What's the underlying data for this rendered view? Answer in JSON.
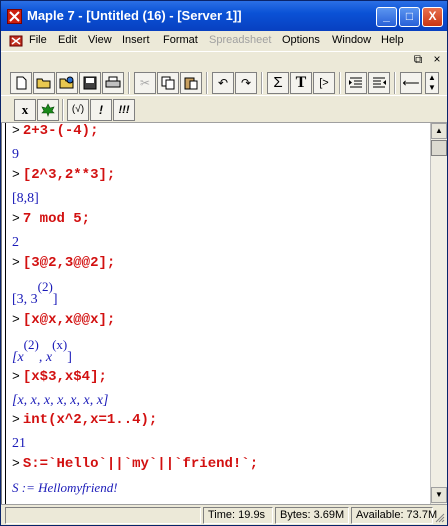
{
  "window": {
    "title": "Maple 7 - [Untitled (16) - [Server 1]]",
    "title_buttons": [
      "_",
      "□",
      "X"
    ]
  },
  "menubar": {
    "items": [
      "File",
      "Edit",
      "View",
      "Insert",
      "Format",
      "Spreadsheet",
      "Options",
      "Window",
      "Help"
    ],
    "disabled": [
      "Spreadsheet"
    ],
    "mdi_buttons": [
      "_",
      "⧉",
      "×"
    ]
  },
  "toolbar": {
    "icons": [
      "new-file-icon",
      "open-folder-icon",
      "open-url-icon",
      "save-icon",
      "print-icon",
      "cut-icon",
      "copy-icon",
      "paste-icon",
      "undo-icon",
      "redo-icon",
      "sum-icon",
      "text-icon",
      "prompt-icon",
      "indent-icon",
      "outdent-icon",
      "back-icon",
      "scroll-icon"
    ],
    "sigma": "Σ",
    "text_T": "T",
    "prompt_label": "[>"
  },
  "toolbar2": {
    "x_label": "x",
    "tree_icon": "maple-leaf-icon",
    "sqrt_label": "(√)",
    "exec_label": "!",
    "execall_label": "!!!"
  },
  "worksheet": {
    "prompt_symbol": ">",
    "entries": [
      {
        "input": "2+3-(-4);",
        "output": "9"
      },
      {
        "input": "[2^3,2**3];",
        "output": "[8,8]"
      },
      {
        "input": "7 mod 5;",
        "output": "2"
      },
      {
        "input": "[3@2,3@@2];",
        "output_base": "[3, 3",
        "output_sup": "(2)",
        "output_end": "]"
      },
      {
        "input": "[x@x,x@@x];",
        "output_base1": "[x",
        "output_sup1": "(2)",
        "output_mid": ", x",
        "output_sup2": "(x)",
        "output_end": "]"
      },
      {
        "input": "[x$3,x$4];",
        "output": "[x, x, x, x, x, x, x]"
      },
      {
        "input": "int(x^2,x=1..4);",
        "output": "21"
      },
      {
        "input": "S:=`Hello`||`my`||`friend!`;",
        "output": "S := Hellomyfriend!"
      }
    ]
  },
  "statusbar": {
    "time": "Time:  19.9s",
    "bytes": "Bytes: 3.69M",
    "available": "Available: 73.7M"
  },
  "colors": {
    "input": "#d21010",
    "output": "#1a1ab8",
    "titlebar": "#0a52d6"
  }
}
